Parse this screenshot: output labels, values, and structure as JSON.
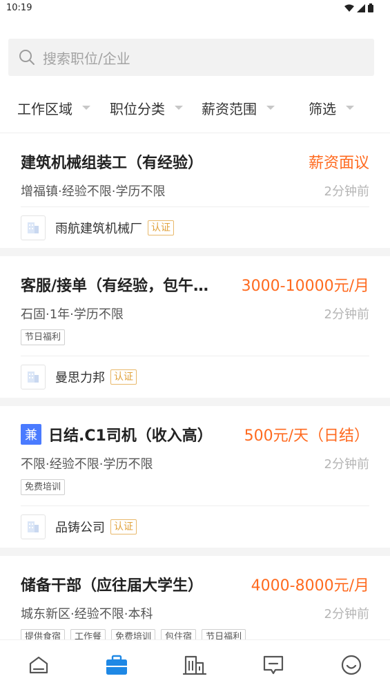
{
  "status_bar": {
    "time": "10:19"
  },
  "search": {
    "placeholder": "搜索职位/企业"
  },
  "filters": [
    {
      "label": "工作区域"
    },
    {
      "label": "职位分类"
    },
    {
      "label": "薪资范围"
    },
    {
      "label": "筛选"
    }
  ],
  "jobs": [
    {
      "title": "建筑机械组装工（有经验）",
      "salary": "薪资面议",
      "meta": "增福镇·经验不限·学历不限",
      "time": "2分钟前",
      "benefits": [],
      "company": "雨航建筑机械厂",
      "verified": "认证"
    },
    {
      "title": "客服/接单（有经验，包午…",
      "salary": "3000-10000元/月",
      "meta": "石固·1年·学历不限",
      "time": "2分钟前",
      "benefits": [
        "节日福利"
      ],
      "company": "曼思力邦",
      "verified": "认证"
    },
    {
      "tag": "兼",
      "title": "日结.C1司机（收入高）",
      "salary": "500元/天（日结）",
      "meta": "不限·经验不限·学历不限",
      "time": "2分钟前",
      "benefits": [
        "免费培训"
      ],
      "company": "品铸公司",
      "verified": "认证"
    },
    {
      "title": "储备干部（应往届大学生）",
      "salary": "4000-8000元/月",
      "meta": "城东新区·经验不限·本科",
      "time": "2分钟前",
      "benefits": [
        "提供食宿",
        "工作餐",
        "免费培训",
        "包住宿",
        "节日福利"
      ]
    }
  ],
  "tabbar": {
    "items": [
      {
        "icon": "home-icon",
        "active": false
      },
      {
        "icon": "briefcase-icon",
        "active": true
      },
      {
        "icon": "building-icon",
        "active": false
      },
      {
        "icon": "message-icon",
        "active": false
      },
      {
        "icon": "smiley-icon",
        "active": false
      }
    ]
  },
  "colors": {
    "accent": "#1e88e5",
    "salary": "#ff6a1f",
    "verified": "#e0a23c",
    "part_time_tag": "#4a7bff"
  }
}
